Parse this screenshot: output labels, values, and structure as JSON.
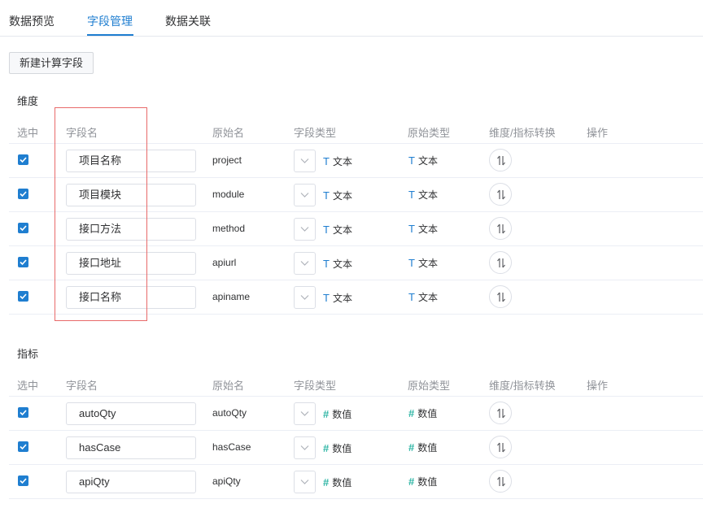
{
  "tabs": [
    {
      "label": "数据预览",
      "active": false
    },
    {
      "label": "字段管理",
      "active": true
    },
    {
      "label": "数据关联",
      "active": false
    }
  ],
  "toolbar": {
    "new_calc_field": "新建计算字段"
  },
  "columns": {
    "select": "选中",
    "field_name": "字段名",
    "original_name": "原始名",
    "field_type": "字段类型",
    "original_type": "原始类型",
    "convert": "维度/指标转换",
    "action": "操作"
  },
  "dimensions": {
    "title": "维度",
    "rows": [
      {
        "checked": true,
        "name": "项目名称",
        "original": "project",
        "type": "文本",
        "original_type": "文本",
        "type_icon": "text-type-icon"
      },
      {
        "checked": true,
        "name": "项目模块",
        "original": "module",
        "type": "文本",
        "original_type": "文本",
        "type_icon": "text-type-icon"
      },
      {
        "checked": true,
        "name": "接口方法",
        "original": "method",
        "type": "文本",
        "original_type": "文本",
        "type_icon": "text-type-icon"
      },
      {
        "checked": true,
        "name": "接口地址",
        "original": "apiurl",
        "type": "文本",
        "original_type": "文本",
        "type_icon": "text-type-icon"
      },
      {
        "checked": true,
        "name": "接口名称",
        "original": "apiname",
        "type": "文本",
        "original_type": "文本",
        "type_icon": "text-type-icon"
      }
    ]
  },
  "metrics": {
    "title": "指标",
    "rows": [
      {
        "checked": true,
        "name": "autoQty",
        "original": "autoQty",
        "type": "数值",
        "original_type": "数值",
        "type_icon": "number-type-icon"
      },
      {
        "checked": true,
        "name": "hasCase",
        "original": "hasCase",
        "type": "数值",
        "original_type": "数值",
        "type_icon": "number-type-icon"
      },
      {
        "checked": true,
        "name": "apiQty",
        "original": "apiQty",
        "type": "数值",
        "original_type": "数值",
        "type_icon": "number-type-icon"
      }
    ]
  },
  "icon_glyphs": {
    "text": "T",
    "number": "#"
  },
  "colors": {
    "accent": "#1f7ed0",
    "number_icon": "#30b6a6",
    "highlight_box": "#e86a6a"
  }
}
